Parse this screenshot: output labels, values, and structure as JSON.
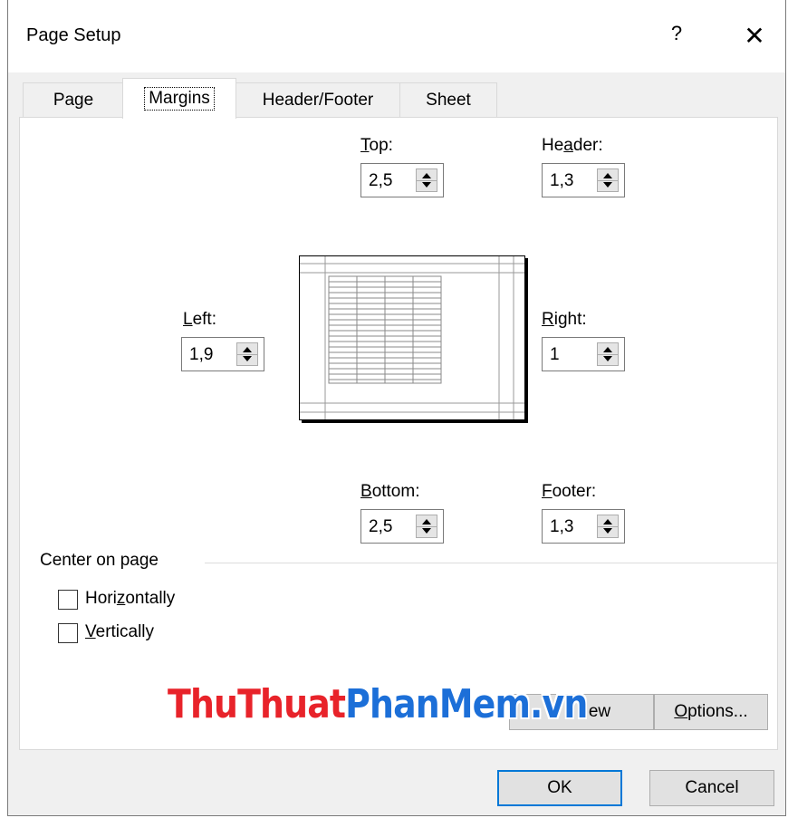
{
  "dialog": {
    "title": "Page Setup",
    "help_glyph": "?",
    "close_glyph": "✕"
  },
  "tabs": [
    {
      "label": "Page",
      "active": false
    },
    {
      "label": "Margins",
      "active": true
    },
    {
      "label": "Header/Footer",
      "active": false
    },
    {
      "label": "Sheet",
      "active": false
    }
  ],
  "margins": {
    "top": {
      "label_pre": "",
      "label_acc": "T",
      "label_post": "op:",
      "value": "2,5"
    },
    "header": {
      "label_pre": "He",
      "label_acc": "a",
      "label_post": "der:",
      "value": "1,3"
    },
    "left": {
      "label_pre": "",
      "label_acc": "L",
      "label_post": "eft:",
      "value": "1,9"
    },
    "right": {
      "label_pre": "",
      "label_acc": "R",
      "label_post": "ight:",
      "value": "1"
    },
    "bottom": {
      "label_pre": "",
      "label_acc": "B",
      "label_post": "ottom:",
      "value": "2,5"
    },
    "footer": {
      "label_pre": "",
      "label_acc": "F",
      "label_post": "ooter:",
      "value": "1,3"
    }
  },
  "center_on_page": {
    "heading": "Center on page",
    "horizontally": {
      "pre": "Hori",
      "acc": "z",
      "post": "ontally",
      "checked": false
    },
    "vertically": {
      "pre": "",
      "acc": "V",
      "post": "ertically",
      "checked": false
    }
  },
  "buttons": {
    "print_preview_fragment": "ew",
    "options": {
      "pre": "",
      "acc": "O",
      "post": "ptions..."
    },
    "ok": "OK",
    "cancel": "Cancel"
  },
  "watermark": {
    "part1": "ThuThuat",
    "part2": "PhanMem.vn",
    "color1": "#e8232a",
    "color2": "#1c6fd8"
  },
  "colors": {
    "default_button_border": "#0078d7",
    "dialog_bg": "#f0f0f0"
  }
}
